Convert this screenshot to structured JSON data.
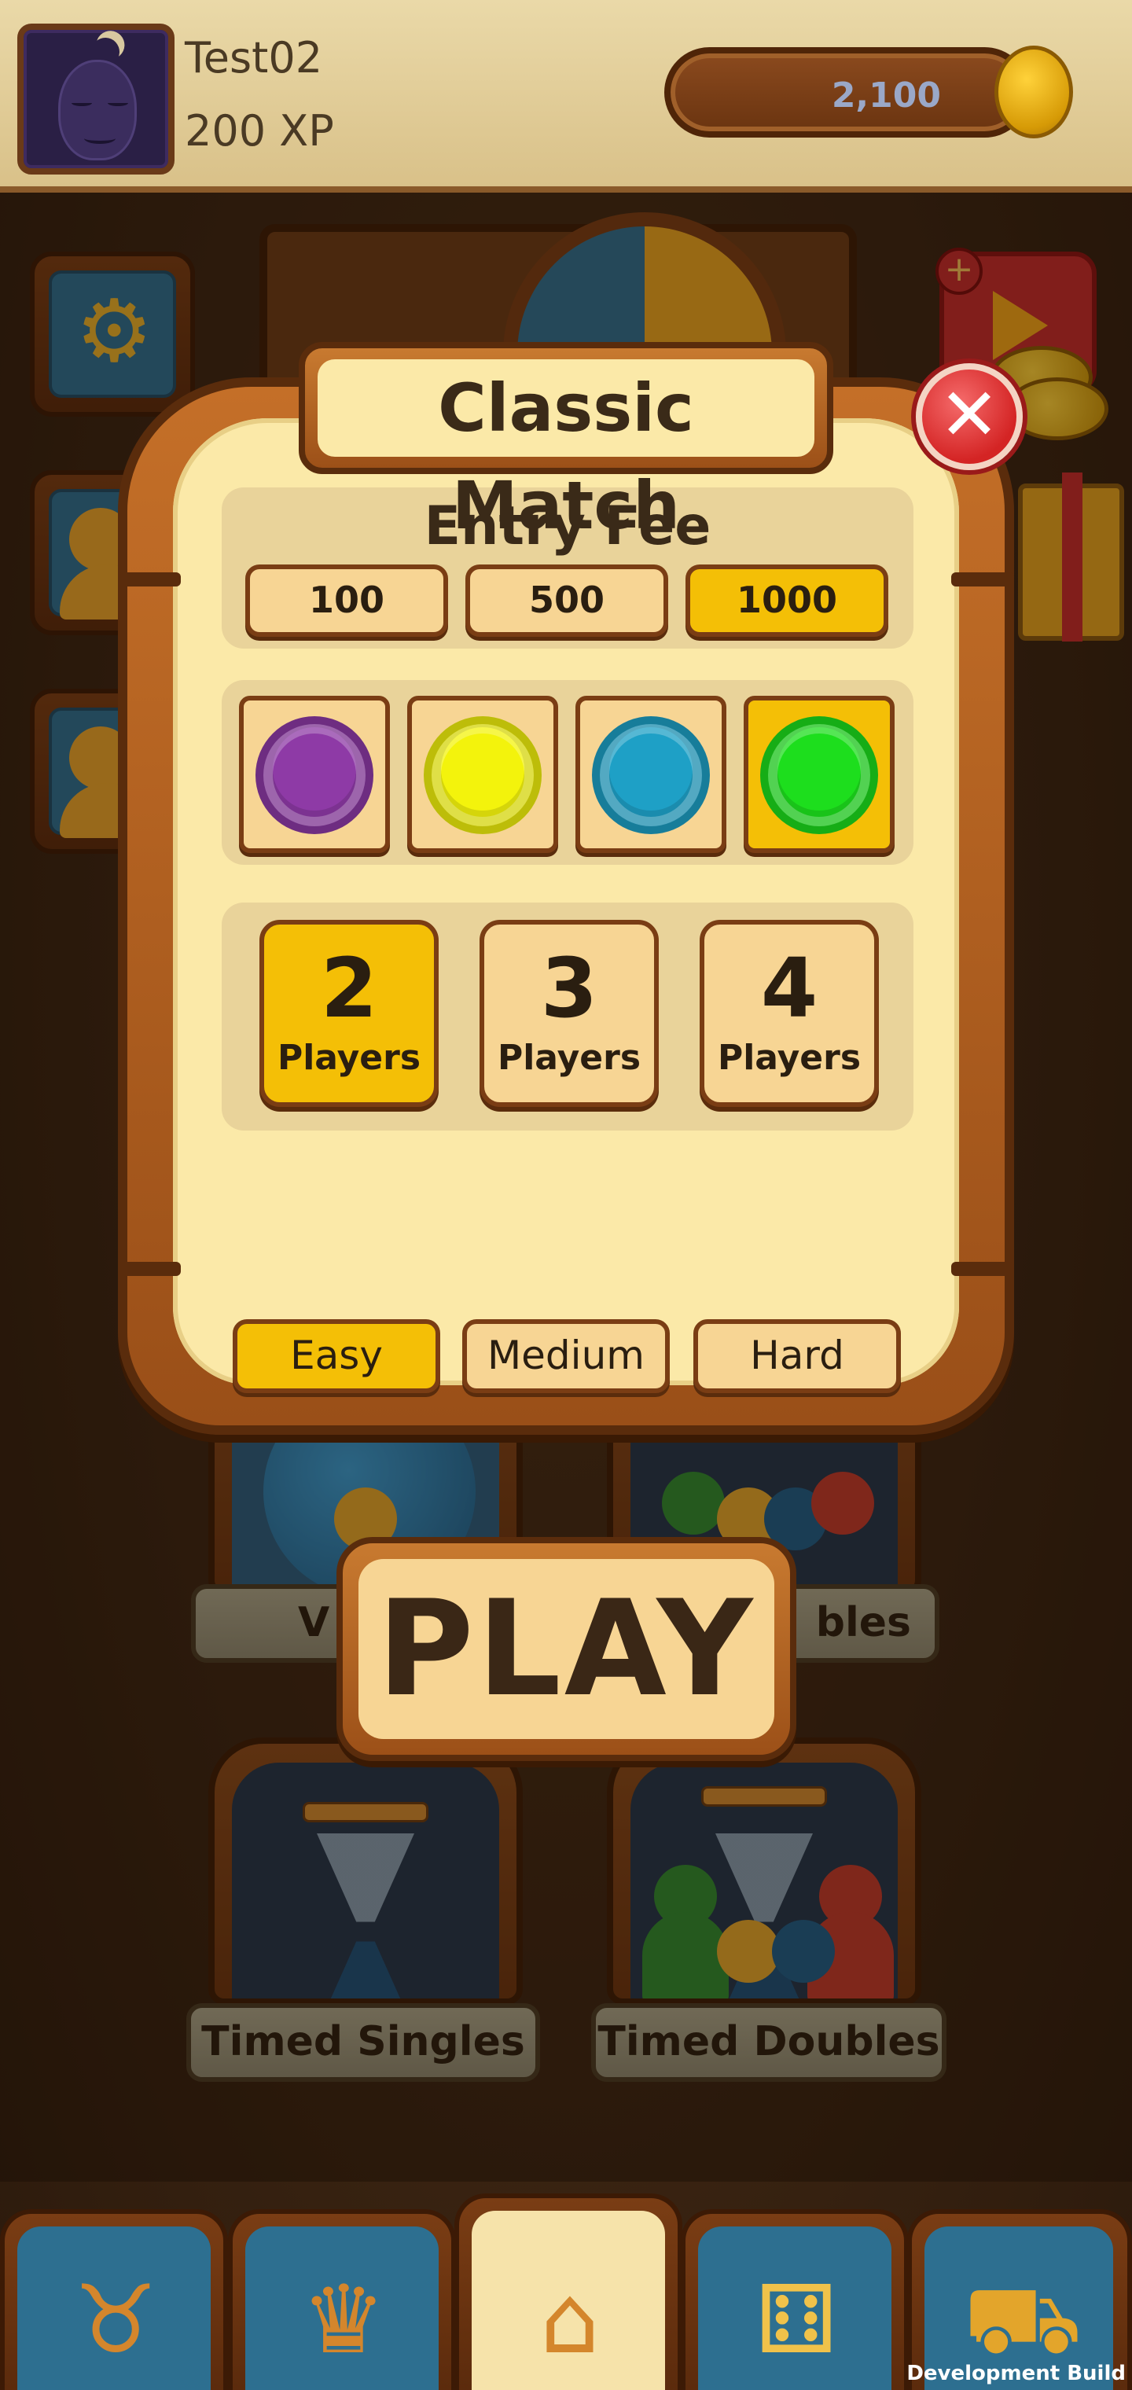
{
  "header": {
    "player_name": "Test02",
    "xp": "200 XP",
    "coins": "2,100"
  },
  "modal": {
    "title": "Classic Match",
    "entry_fee": {
      "label": "Entry Fee",
      "options": [
        "100",
        "500",
        "1000"
      ],
      "selected_index": 2
    },
    "colors": {
      "options": [
        {
          "name": "purple",
          "hex": "#8e3aa6"
        },
        {
          "name": "yellow",
          "hex": "#f3f30c"
        },
        {
          "name": "blue",
          "hex": "#1ea0c6"
        },
        {
          "name": "green",
          "hex": "#1dde1d"
        }
      ],
      "selected_index": 3
    },
    "players": {
      "options": [
        {
          "count": "2",
          "word": "Players"
        },
        {
          "count": "3",
          "word": "Players"
        },
        {
          "count": "4",
          "word": "Players"
        }
      ],
      "selected_index": 0
    },
    "difficulty": {
      "options": [
        "Easy",
        "Medium",
        "Hard"
      ],
      "selected_index": 0
    }
  },
  "background_modes": {
    "partial_left": "V",
    "partial_right": "bles",
    "timed_singles": "Timed Singles",
    "timed_doubles": "Timed Doubles"
  },
  "play_label": "PLAY",
  "bottom_nav": [
    {
      "icon": "bull-icon"
    },
    {
      "icon": "crown-icon"
    },
    {
      "icon": "hut-icon",
      "active": true
    },
    {
      "icon": "dice-icon"
    },
    {
      "icon": "cart-icon"
    }
  ],
  "dev_build": "Development Build",
  "colors": {
    "selected": "#f4bf06",
    "button": "#f7d594",
    "panel": "#fbe9a8",
    "wood": "#9c5018",
    "tile_blue": "#2d6f90"
  }
}
